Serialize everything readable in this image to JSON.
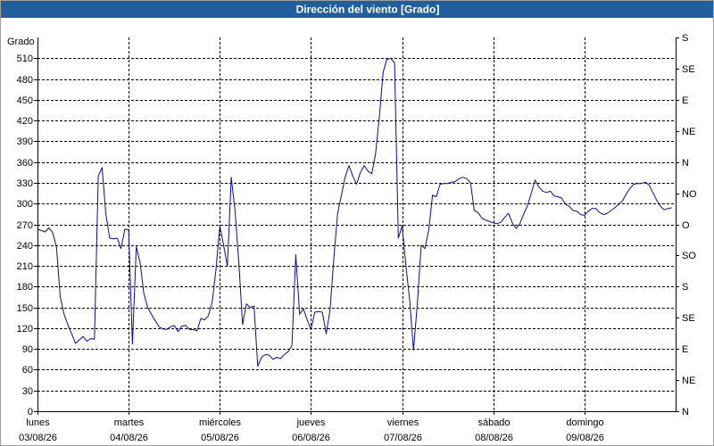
{
  "colors": {
    "title_bar": "#215e9b",
    "title_text": "#ffffff",
    "series": "#0b0b98",
    "grid": "#000000",
    "frame": "#a0a0a0"
  },
  "chart_data": {
    "type": "line",
    "title": "Dirección del viento [Grado]",
    "ylabel": "Grado",
    "ylim": [
      0,
      540
    ],
    "xlim": [
      "03/08/26 00:00",
      "10/08/26 00:00"
    ],
    "grid": true,
    "y_ticks": [
      0,
      30,
      60,
      90,
      120,
      150,
      180,
      210,
      240,
      270,
      300,
      330,
      360,
      390,
      420,
      450,
      480,
      510
    ],
    "y2_ticks": [
      {
        "value": 0,
        "label": "N"
      },
      {
        "value": 45,
        "label": "NE"
      },
      {
        "value": 90,
        "label": "E"
      },
      {
        "value": 135,
        "label": "SE"
      },
      {
        "value": 180,
        "label": "S"
      },
      {
        "value": 225,
        "label": "SO"
      },
      {
        "value": 270,
        "label": "O"
      },
      {
        "value": 315,
        "label": "NO"
      },
      {
        "value": 360,
        "label": "N"
      },
      {
        "value": 405,
        "label": "NE"
      },
      {
        "value": 450,
        "label": "E"
      },
      {
        "value": 495,
        "label": "SE"
      },
      {
        "value": 540,
        "label": "S"
      }
    ],
    "x_ticks": [
      {
        "day": "lunes",
        "date": "03/08/26"
      },
      {
        "day": "martes",
        "date": "04/08/26"
      },
      {
        "day": "miércoles",
        "date": "05/08/26"
      },
      {
        "day": "jueves",
        "date": "06/08/26"
      },
      {
        "day": "viernes",
        "date": "07/08/26"
      },
      {
        "day": "sábado",
        "date": "08/08/26"
      },
      {
        "day": "domingo",
        "date": "09/08/26"
      }
    ],
    "x": [
      "03/08/26 00:00",
      "03/08/26 01:00",
      "03/08/26 02:00",
      "03/08/26 03:00",
      "03/08/26 04:00",
      "03/08/26 05:00",
      "03/08/26 06:00",
      "03/08/26 07:00",
      "03/08/26 08:00",
      "03/08/26 09:00",
      "03/08/26 10:00",
      "03/08/26 11:00",
      "03/08/26 12:00",
      "03/08/26 13:00",
      "03/08/26 14:00",
      "03/08/26 15:00",
      "03/08/26 16:00",
      "03/08/26 17:00",
      "03/08/26 18:00",
      "03/08/26 19:00",
      "03/08/26 20:00",
      "03/08/26 21:00",
      "03/08/26 22:00",
      "03/08/26 23:00",
      "04/08/26 00:00",
      "04/08/26 01:00",
      "04/08/26 02:00",
      "04/08/26 03:00",
      "04/08/26 04:00",
      "04/08/26 05:00",
      "04/08/26 06:00",
      "04/08/26 07:00",
      "04/08/26 08:00",
      "04/08/26 09:00",
      "04/08/26 10:00",
      "04/08/26 11:00",
      "04/08/26 12:00",
      "04/08/26 13:00",
      "04/08/26 14:00",
      "04/08/26 15:00",
      "04/08/26 16:00",
      "04/08/26 17:00",
      "04/08/26 18:00",
      "04/08/26 19:00",
      "04/08/26 20:00",
      "04/08/26 21:00",
      "04/08/26 22:00",
      "04/08/26 23:00",
      "05/08/26 00:00",
      "05/08/26 01:00",
      "05/08/26 02:00",
      "05/08/26 03:00",
      "05/08/26 04:00",
      "05/08/26 05:00",
      "05/08/26 06:00",
      "05/08/26 07:00",
      "05/08/26 08:00",
      "05/08/26 09:00",
      "05/08/26 10:00",
      "05/08/26 11:00",
      "05/08/26 12:00",
      "05/08/26 13:00",
      "05/08/26 14:00",
      "05/08/26 15:00",
      "05/08/26 16:00",
      "05/08/26 17:00",
      "05/08/26 18:00",
      "05/08/26 19:00",
      "05/08/26 20:00",
      "05/08/26 21:00",
      "05/08/26 22:00",
      "05/08/26 23:00",
      "06/08/26 00:00",
      "06/08/26 01:00",
      "06/08/26 02:00",
      "06/08/26 03:00",
      "06/08/26 04:00",
      "06/08/26 05:00",
      "06/08/26 06:00",
      "06/08/26 07:00",
      "06/08/26 08:00",
      "06/08/26 09:00",
      "06/08/26 10:00",
      "06/08/26 11:00",
      "06/08/26 12:00",
      "06/08/26 13:00",
      "06/08/26 14:00",
      "06/08/26 15:00",
      "06/08/26 16:00",
      "06/08/26 17:00",
      "06/08/26 18:00",
      "06/08/26 19:00",
      "06/08/26 20:00",
      "06/08/26 21:00",
      "06/08/26 22:00",
      "06/08/26 23:00",
      "07/08/26 00:00",
      "07/08/26 01:00",
      "07/08/26 02:00",
      "07/08/26 03:00",
      "07/08/26 04:00",
      "07/08/26 05:00",
      "07/08/26 06:00",
      "07/08/26 07:00",
      "07/08/26 08:00",
      "07/08/26 09:00",
      "07/08/26 10:00",
      "07/08/26 11:00",
      "07/08/26 12:00",
      "07/08/26 13:00",
      "07/08/26 14:00",
      "07/08/26 15:00",
      "07/08/26 16:00",
      "07/08/26 17:00",
      "07/08/26 18:00",
      "07/08/26 19:00",
      "07/08/26 20:00",
      "07/08/26 21:00",
      "07/08/26 22:00",
      "07/08/26 23:00",
      "08/08/26 00:00",
      "08/08/26 01:00",
      "08/08/26 02:00",
      "08/08/26 03:00",
      "08/08/26 04:00",
      "08/08/26 05:00",
      "08/08/26 06:00",
      "08/08/26 07:00",
      "08/08/26 08:00",
      "08/08/26 09:00",
      "08/08/26 10:00",
      "08/08/26 11:00",
      "08/08/26 12:00",
      "08/08/26 13:00",
      "08/08/26 14:00",
      "08/08/26 15:00",
      "08/08/26 16:00",
      "08/08/26 17:00",
      "08/08/26 18:00",
      "08/08/26 19:00",
      "08/08/26 20:00",
      "08/08/26 21:00",
      "08/08/26 22:00",
      "08/08/26 23:00",
      "09/08/26 00:00",
      "09/08/26 01:00",
      "09/08/26 02:00",
      "09/08/26 03:00",
      "09/08/26 04:00",
      "09/08/26 05:00",
      "09/08/26 06:00",
      "09/08/26 07:00",
      "09/08/26 08:00",
      "09/08/26 09:00",
      "09/08/26 10:00",
      "09/08/26 11:00",
      "09/08/26 12:00",
      "09/08/26 13:00",
      "09/08/26 14:00",
      "09/08/26 15:00",
      "09/08/26 16:00",
      "09/08/26 17:00",
      "09/08/26 18:00",
      "09/08/26 19:00",
      "09/08/26 20:00",
      "09/08/26 21:00",
      "09/08/26 22:00",
      "09/08/26 23:00"
    ],
    "y": [
      263,
      261,
      259,
      265,
      258,
      237,
      165,
      140,
      125,
      112,
      98,
      103,
      108,
      101,
      105,
      104,
      340,
      352,
      285,
      250,
      249,
      250,
      235,
      263,
      262,
      97,
      238,
      215,
      170,
      150,
      140,
      131,
      122,
      119,
      118,
      122,
      124,
      115,
      123,
      124,
      118,
      118,
      116,
      134,
      132,
      138,
      158,
      205,
      268,
      240,
      210,
      338,
      290,
      215,
      125,
      155,
      150,
      152,
      65,
      78,
      82,
      81,
      75,
      78,
      76,
      82,
      86,
      95,
      226,
      140,
      148,
      132,
      118,
      143,
      144,
      143,
      112,
      145,
      220,
      285,
      312,
      338,
      355,
      340,
      328,
      345,
      355,
      347,
      343,
      372,
      425,
      490,
      508,
      510,
      503,
      250,
      268,
      210,
      160,
      88,
      155,
      240,
      235,
      262,
      312,
      310,
      328,
      329,
      329,
      331,
      332,
      336,
      338,
      336,
      330,
      290,
      287,
      279,
      276,
      274,
      272,
      271,
      273,
      280,
      286,
      272,
      264,
      271,
      285,
      297,
      315,
      334,
      324,
      318,
      316,
      318,
      311,
      310,
      308,
      299,
      296,
      290,
      289,
      284,
      283,
      289,
      293,
      293,
      287,
      284,
      286,
      290,
      294,
      299,
      304,
      314,
      322,
      328,
      329,
      329,
      331,
      327,
      316,
      305,
      296,
      291,
      293,
      294
    ]
  }
}
